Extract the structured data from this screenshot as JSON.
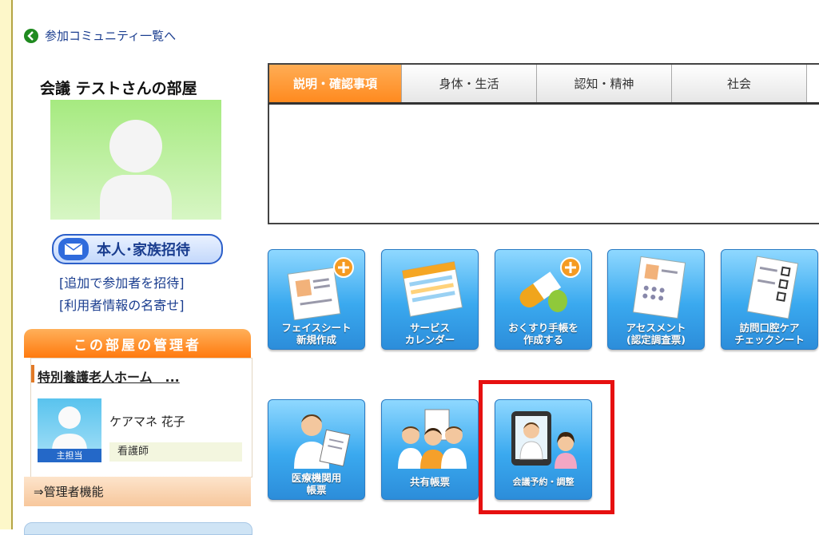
{
  "nav": {
    "back_label": "参加コミュニティ一覧へ"
  },
  "room": {
    "title": "会議 テストさんの部屋",
    "invite_label": "本人･家族招待",
    "links": [
      "[追加で参加者を招待]",
      "[利用者情報の名寄せ]"
    ]
  },
  "admin": {
    "header": "この部屋の管理者",
    "facility": "特別養護老人ホーム　...",
    "staff_name": "ケアマネ 花子",
    "staff_badge": "主担当",
    "staff_role": "看護師",
    "function_link": "⇒管理者機能"
  },
  "tabs": [
    {
      "label": "説明・確認事項",
      "active": true
    },
    {
      "label": "身体・生活",
      "active": false
    },
    {
      "label": "認知・精神",
      "active": false
    },
    {
      "label": "社会",
      "active": false
    }
  ],
  "tiles": [
    {
      "line1": "フェイスシート",
      "line2": "新規作成",
      "icon": "face-sheet-icon"
    },
    {
      "line1": "サービス",
      "line2": "カレンダー",
      "icon": "calendar-icon"
    },
    {
      "line1": "おくすり手帳を",
      "line2": "作成する",
      "icon": "medicine-icon"
    },
    {
      "line1": "アセスメント",
      "line2": "(認定調査票)",
      "icon": "assessment-icon"
    },
    {
      "line1": "訪問口腔ケア",
      "line2": "チェックシート",
      "icon": "checklist-icon"
    },
    {
      "line1": "医療機関用",
      "line2": "帳票",
      "icon": "doctor-clipboard-icon"
    },
    {
      "line1": "共有帳票",
      "line2": "",
      "icon": "staff-group-icon"
    },
    {
      "line1": "会議予約・調整",
      "line2": "",
      "icon": "tablet-meeting-icon"
    }
  ],
  "colors": {
    "accent_orange": "#ff8a1f",
    "link_blue": "#1a3d8f",
    "tile_blue": "#3aa9ef",
    "highlight_red": "#e61010"
  }
}
